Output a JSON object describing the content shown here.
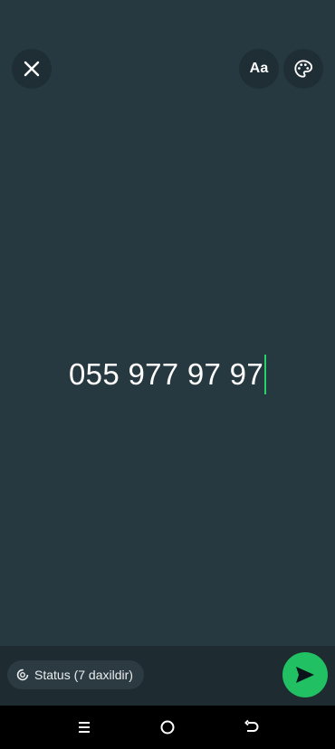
{
  "top_bar": {
    "close_icon": "close-icon",
    "font_button_label": "Aa",
    "palette_icon": "palette-icon"
  },
  "composer": {
    "text": "055 977 97 97",
    "caret_color": "#25d366",
    "background_color": "#263840"
  },
  "footer": {
    "audience_label": "Status (7 daxildir)",
    "audience_icon": "status-ring-icon",
    "send_icon": "send-icon",
    "send_color": "#21c063"
  },
  "system_nav": {
    "menu_icon": "recent-apps-icon",
    "home_icon": "home-icon",
    "back_icon": "back-icon"
  }
}
